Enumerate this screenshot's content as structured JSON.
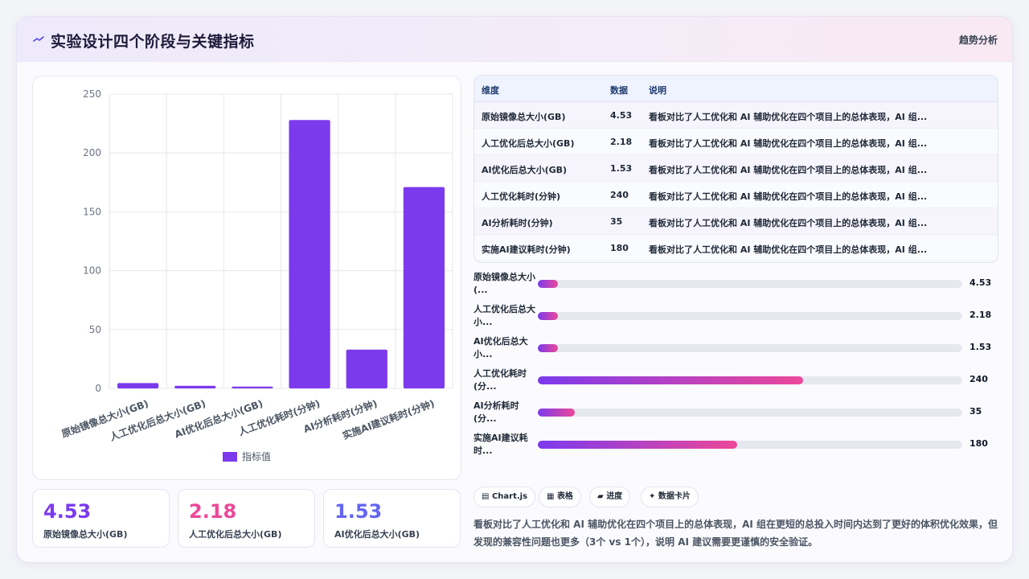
{
  "header": {
    "title": "实验设计四个阶段与关键指标",
    "link": "趋势分析",
    "icon": "sparkle-line-icon"
  },
  "chart_data": {
    "type": "bar",
    "categories": [
      "原始镜像总大小(GB)",
      "人工优化后总大小(GB)",
      "AI优化后总大小(GB)",
      "人工优化耗时(分钟)",
      "AI分析耗时(分钟)",
      "实施AI建议耗时(分钟)"
    ],
    "series": [
      {
        "name": "指标值",
        "values": [
          4.53,
          2.18,
          1.53,
          228,
          33,
          171
        ],
        "color": "#7c3aed"
      }
    ],
    "ylim": [
      0,
      250
    ],
    "yticks": [
      "0",
      "50",
      "100",
      "150",
      "200",
      "250"
    ],
    "grid": true,
    "legend": "bottom"
  },
  "kpis": [
    {
      "value": "4.53",
      "label": "原始镜像总大小(GB)",
      "color": "#7c3aed"
    },
    {
      "value": "2.18",
      "label": "人工优化后总大小(GB)",
      "color": "#ec4899"
    },
    {
      "value": "1.53",
      "label": "AI优化后总大小(GB)",
      "color": "#6366f1"
    }
  ],
  "table": {
    "headers": [
      "维度",
      "数据",
      "说明"
    ],
    "rows": [
      [
        "原始镜像总大小(GB)",
        "4.53",
        "看板对比了人工优化和 AI 辅助优化在四个项目上的总体表现，AI 组..."
      ],
      [
        "人工优化后总大小(GB)",
        "2.18",
        "看板对比了人工优化和 AI 辅助优化在四个项目上的总体表现，AI 组..."
      ],
      [
        "AI优化后总大小(GB)",
        "1.53",
        "看板对比了人工优化和 AI 辅助优化在四个项目上的总体表现，AI 组..."
      ],
      [
        "人工优化耗时(分钟)",
        "240",
        "看板对比了人工优化和 AI 辅助优化在四个项目上的总体表现，AI 组..."
      ],
      [
        "AI分析耗时(分钟)",
        "35",
        "看板对比了人工优化和 AI 辅助优化在四个项目上的总体表现，AI 组..."
      ],
      [
        "实施AI建议耗时(分钟)",
        "180",
        "看板对比了人工优化和 AI 辅助优化在四个项目上的总体表现，AI 组..."
      ]
    ]
  },
  "progress": [
    {
      "label": "原始镜像总大小(...",
      "value": "4.53",
      "fraction": 0.047
    },
    {
      "label": "人工优化后总大小...",
      "value": "2.18",
      "fraction": 0.047
    },
    {
      "label": "AI优化后总大小...",
      "value": "1.53",
      "fraction": 0.047
    },
    {
      "label": "人工优化耗时(分...",
      "value": "240",
      "fraction": 0.625
    },
    {
      "label": "AI分析耗时(分...",
      "value": "35",
      "fraction": 0.087
    },
    {
      "label": "实施AI建议耗时...",
      "value": "180",
      "fraction": 0.469
    }
  ],
  "chips": [
    {
      "label": "Chart.js",
      "icon": "chart-icon",
      "glyph": "▤"
    },
    {
      "label": "表格",
      "icon": "table-icon",
      "glyph": "▦"
    },
    {
      "label": "进度",
      "icon": "progress-icon",
      "glyph": "▰"
    },
    {
      "label": "数据卡片",
      "icon": "card-icon",
      "glyph": "✦"
    }
  ],
  "summary": "看板对比了人工优化和 AI 辅助优化在四个项目上的总体表现，AI 组在更短的总投入时间内达到了更好的体积优化效果，但发现的兼容性问题也更多（3个 vs 1个），说明 AI 建议需要更谨慎的安全验证。"
}
